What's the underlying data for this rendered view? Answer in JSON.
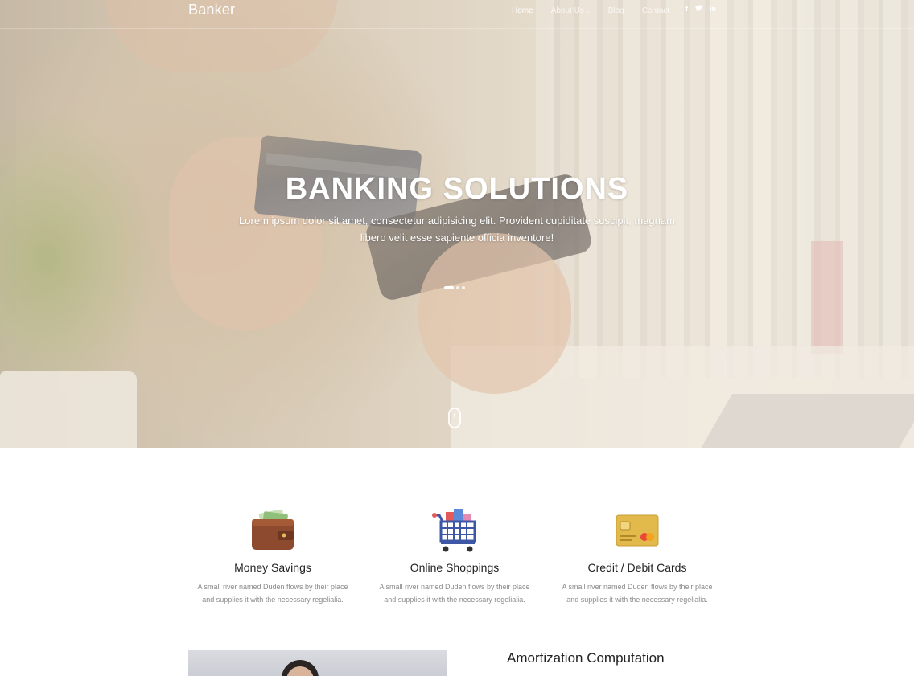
{
  "nav": {
    "brand": "Banker",
    "items": [
      {
        "label": "Home"
      },
      {
        "label": "About Us",
        "dropdown": true
      },
      {
        "label": "Blog"
      },
      {
        "label": "Contact"
      }
    ],
    "socials": [
      "f",
      "t",
      "in"
    ]
  },
  "hero": {
    "title": "BANKING SOLUTIONS",
    "subtitle": "Lorem ipsum dolor sit amet, consectetur adipisicing elit. Provident cupiditate suscipit, magnam libero velit esse sapiente officia inventore!",
    "slide_dots": 3,
    "active_slide": 1
  },
  "features": [
    {
      "title": "Money Savings",
      "desc": "A small river named Duden flows by their place and supplies it with the necessary regelialia.",
      "icon": "wallet-icon"
    },
    {
      "title": "Online Shoppings",
      "desc": "A small river named Duden flows by their place and supplies it with the necessary regelialia.",
      "icon": "shopping-cart-icon"
    },
    {
      "title": "Credit / Debit Cards",
      "desc": "A small river named Duden flows by their place and supplies it with the necessary regelialia.",
      "icon": "credit-card-icon"
    }
  ],
  "section": {
    "title": "Amortization Computation"
  },
  "colors": {
    "hero_overlay": "#eee2d0",
    "wallet": "#8d4a2e",
    "cart": "#3d57a6",
    "card": "#e2b94b"
  }
}
